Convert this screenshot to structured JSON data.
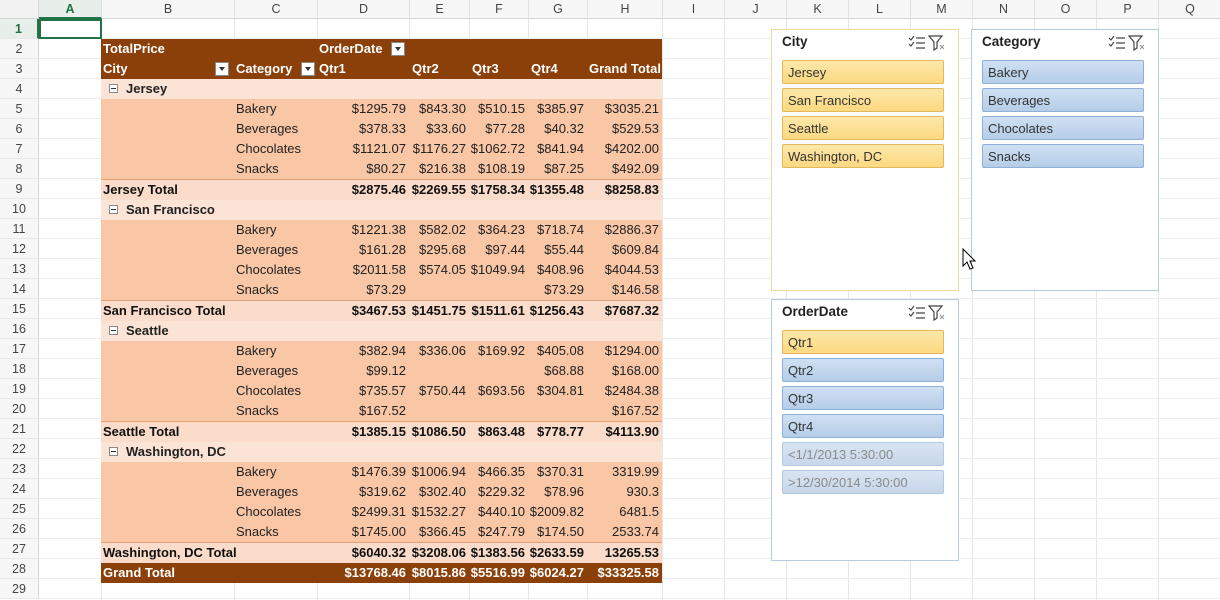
{
  "sheet": {
    "columns": [
      "A",
      "B",
      "C",
      "D",
      "E",
      "F",
      "G",
      "H",
      "I",
      "J",
      "K",
      "L",
      "M",
      "N",
      "O",
      "P",
      "Q"
    ],
    "rows": [
      "1",
      "2",
      "3",
      "4",
      "5",
      "6",
      "7",
      "8",
      "9",
      "10",
      "11",
      "12",
      "13",
      "14",
      "15",
      "16",
      "17",
      "18",
      "19",
      "20",
      "21",
      "22",
      "23",
      "24",
      "25",
      "26",
      "27",
      "28",
      "29"
    ],
    "active_cell": "A1"
  },
  "pivot": {
    "values_field": "TotalPrice",
    "column_field": "OrderDate",
    "row_headers": {
      "city": "City",
      "category": "Category",
      "qtr1": "Qtr1",
      "qtr2": "Qtr2",
      "qtr3": "Qtr3",
      "qtr4": "Qtr4",
      "grand_total": "Grand Total"
    },
    "cities": [
      {
        "name": "Jersey",
        "rows": [
          {
            "category": "Bakery",
            "q1": "$1295.79",
            "q2": "$843.30",
            "q3": "$510.15",
            "q4": "$385.97",
            "total": "$3035.21"
          },
          {
            "category": "Beverages",
            "q1": "$378.33",
            "q2": "$33.60",
            "q3": "$77.28",
            "q4": "$40.32",
            "total": "$529.53"
          },
          {
            "category": "Chocolates",
            "q1": "$1121.07",
            "q2": "$1176.27",
            "q3": "$1062.72",
            "q4": "$841.94",
            "total": "$4202.00"
          },
          {
            "category": "Snacks",
            "q1": "$80.27",
            "q2": "$216.38",
            "q3": "$108.19",
            "q4": "$87.25",
            "total": "$492.09"
          }
        ],
        "total_label": "Jersey Total",
        "totals": {
          "q1": "$2875.46",
          "q2": "$2269.55",
          "q3": "$1758.34",
          "q4": "$1355.48",
          "total": "$8258.83"
        }
      },
      {
        "name": "San Francisco",
        "rows": [
          {
            "category": "Bakery",
            "q1": "$1221.38",
            "q2": "$582.02",
            "q3": "$364.23",
            "q4": "$718.74",
            "total": "$2886.37"
          },
          {
            "category": "Beverages",
            "q1": "$161.28",
            "q2": "$295.68",
            "q3": "$97.44",
            "q4": "$55.44",
            "total": "$609.84"
          },
          {
            "category": "Chocolates",
            "q1": "$2011.58",
            "q2": "$574.05",
            "q3": "$1049.94",
            "q4": "$408.96",
            "total": "$4044.53"
          },
          {
            "category": "Snacks",
            "q1": "$73.29",
            "q2": "",
            "q3": "",
            "q4": "$73.29",
            "total": "$146.58"
          }
        ],
        "total_label": "San Francisco Total",
        "totals": {
          "q1": "$3467.53",
          "q2": "$1451.75",
          "q3": "$1511.61",
          "q4": "$1256.43",
          "total": "$7687.32"
        }
      },
      {
        "name": "Seattle",
        "rows": [
          {
            "category": "Bakery",
            "q1": "$382.94",
            "q2": "$336.06",
            "q3": "$169.92",
            "q4": "$405.08",
            "total": "$1294.00"
          },
          {
            "category": "Beverages",
            "q1": "$99.12",
            "q2": "",
            "q3": "",
            "q4": "$68.88",
            "total": "$168.00"
          },
          {
            "category": "Chocolates",
            "q1": "$735.57",
            "q2": "$750.44",
            "q3": "$693.56",
            "q4": "$304.81",
            "total": "$2484.38"
          },
          {
            "category": "Snacks",
            "q1": "$167.52",
            "q2": "",
            "q3": "",
            "q4": "",
            "total": "$167.52"
          }
        ],
        "total_label": "Seattle Total",
        "totals": {
          "q1": "$1385.15",
          "q2": "$1086.50",
          "q3": "$863.48",
          "q4": "$778.77",
          "total": "$4113.90"
        }
      },
      {
        "name": "Washington, DC",
        "rows": [
          {
            "category": "Bakery",
            "q1": "$1476.39",
            "q2": "$1006.94",
            "q3": "$466.35",
            "q4": "$370.31",
            "total": "3319.99"
          },
          {
            "category": "Beverages",
            "q1": "$319.62",
            "q2": "$302.40",
            "q3": "$229.32",
            "q4": "$78.96",
            "total": "930.3"
          },
          {
            "category": "Chocolates",
            "q1": "$2499.31",
            "q2": "$1532.27",
            "q3": "$440.10",
            "q4": "$2009.82",
            "total": "6481.5"
          },
          {
            "category": "Snacks",
            "q1": "$1745.00",
            "q2": "$366.45",
            "q3": "$247.79",
            "q4": "$174.50",
            "total": "2533.74"
          }
        ],
        "total_label": "Washington, DC Total",
        "totals": {
          "q1": "$6040.32",
          "q2": "$3208.06",
          "q3": "$1383.56",
          "q4": "$2633.59",
          "total": "13265.53"
        }
      }
    ],
    "grand_total": {
      "label": "Grand Total",
      "q1": "$13768.46",
      "q2": "$8015.86",
      "q3": "$5516.99",
      "q4": "$6024.27",
      "total": "$33325.58"
    }
  },
  "slicers": {
    "city": {
      "title": "City",
      "items": [
        {
          "label": "Jersey",
          "state": "selected"
        },
        {
          "label": "San Francisco",
          "state": "selected"
        },
        {
          "label": "Seattle",
          "state": "selected"
        },
        {
          "label": "Washington, DC",
          "state": "selected"
        }
      ]
    },
    "category": {
      "title": "Category",
      "items": [
        {
          "label": "Bakery",
          "state": "available"
        },
        {
          "label": "Beverages",
          "state": "available"
        },
        {
          "label": "Chocolates",
          "state": "available"
        },
        {
          "label": "Snacks",
          "state": "available"
        }
      ]
    },
    "orderdate": {
      "title": "OrderDate",
      "items": [
        {
          "label": "Qtr1",
          "state": "selected"
        },
        {
          "label": "Qtr2",
          "state": "available"
        },
        {
          "label": "Qtr3",
          "state": "available"
        },
        {
          "label": "Qtr4",
          "state": "available"
        },
        {
          "label": "<1/1/2013 5:30:00",
          "state": "nodata"
        },
        {
          "label": ">12/30/2014 5:30:00",
          "state": "nodata"
        }
      ]
    }
  },
  "colors": {
    "pivot_header": "#8b3f09",
    "pivot_city_row": "#fbe3d5",
    "pivot_data": "#f9c6a6",
    "slicer_selected": "#fcd981",
    "slicer_available": "#b5cde8",
    "excel_green": "#217346"
  }
}
